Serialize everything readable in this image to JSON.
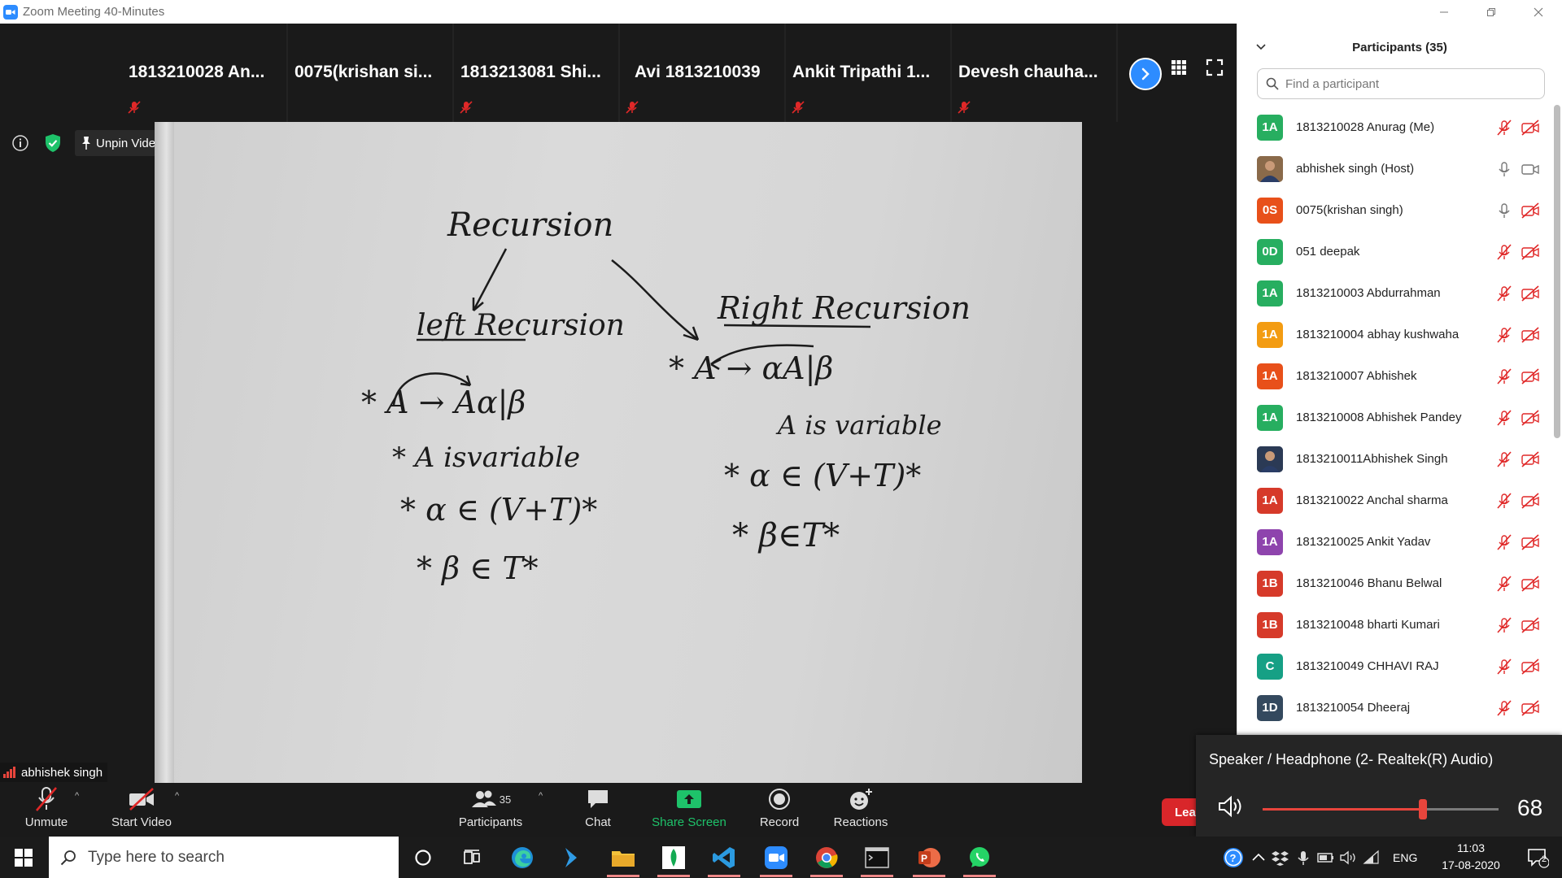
{
  "window": {
    "title": "Zoom Meeting 40-Minutes",
    "controls": [
      "minimize",
      "restore",
      "close"
    ]
  },
  "video_strip": [
    {
      "name": "1813210028  An..."
    },
    {
      "name": "0075(krishan  si..."
    },
    {
      "name": "1813213081  Shi..."
    },
    {
      "name": "Avi 1813210039"
    },
    {
      "name": "Ankit  Tripathi  1..."
    },
    {
      "name": "Devesh  chauha..."
    }
  ],
  "main_video": {
    "unpin_label": "Unpin Video",
    "speaker_name": "abhishek singh",
    "whiteboard": {
      "title": "Recursion",
      "left_heading": "left  Recursion",
      "right_heading": "Right  Recursion",
      "left_lines": [
        "* A → Aα|β",
        "* A isvariable",
        "* α ∈ (V+T)*",
        "* β ∈ T*"
      ],
      "right_lines": [
        "* A → αA|β",
        "A is variable",
        "* α ∈ (V+T)*",
        "* β∈T*"
      ]
    }
  },
  "toolbar": {
    "unmute": "Unmute",
    "start_video": "Start Video",
    "participants": "Participants",
    "participants_count": "35",
    "chat": "Chat",
    "share_screen": "Share Screen",
    "record": "Record",
    "reactions": "Reactions",
    "leave": "Leave"
  },
  "participants_panel": {
    "title": "Participants (35)",
    "search_placeholder": "Find a participant",
    "participants": [
      {
        "initials": "1A",
        "name": "1813210028 Anurag (Me)",
        "color": "#27ae60",
        "mic": "muted",
        "video": "off"
      },
      {
        "initials": "",
        "name": "abhishek singh (Host)",
        "color": "#8a6a4a",
        "mic": "on",
        "video": "on",
        "photo": true
      },
      {
        "initials": "0S",
        "name": "0075(krishan singh)",
        "color": "#e8501a",
        "mic": "on",
        "video": "off"
      },
      {
        "initials": "0D",
        "name": "051 deepak",
        "color": "#27ae60",
        "mic": "muted",
        "video": "off"
      },
      {
        "initials": "1A",
        "name": "1813210003 Abdurrahman",
        "color": "#27ae60",
        "mic": "muted",
        "video": "off"
      },
      {
        "initials": "1A",
        "name": "1813210004 abhay kushwaha",
        "color": "#f39c12",
        "mic": "muted",
        "video": "off"
      },
      {
        "initials": "1A",
        "name": "1813210007 Abhishek",
        "color": "#e8501a",
        "mic": "muted",
        "video": "off"
      },
      {
        "initials": "1A",
        "name": "1813210008 Abhishek Pandey",
        "color": "#27ae60",
        "mic": "muted",
        "video": "off"
      },
      {
        "initials": "",
        "name": "1813210011Abhishek Singh",
        "color": "#2b3a55",
        "mic": "muted",
        "video": "off",
        "photo": true
      },
      {
        "initials": "1A",
        "name": "1813210022 Anchal sharma",
        "color": "#d63a2a",
        "mic": "muted",
        "video": "off"
      },
      {
        "initials": "1A",
        "name": "1813210025 Ankit Yadav",
        "color": "#8e44ad",
        "mic": "muted",
        "video": "off"
      },
      {
        "initials": "1B",
        "name": "1813210046 Bhanu Belwal",
        "color": "#d63a2a",
        "mic": "muted",
        "video": "off"
      },
      {
        "initials": "1B",
        "name": "1813210048 bharti Kumari",
        "color": "#d63a2a",
        "mic": "muted",
        "video": "off"
      },
      {
        "initials": "C",
        "name": "1813210049 CHHAVI RAJ",
        "color": "#16a085",
        "mic": "muted",
        "video": "off"
      },
      {
        "initials": "1D",
        "name": "1813210054 Dheeraj",
        "color": "#34495e",
        "mic": "muted",
        "video": "off"
      }
    ]
  },
  "volume_popup": {
    "device": "Speaker / Headphone (2- Realtek(R) Audio)",
    "value": "68",
    "level_fraction": 0.68
  },
  "taskbar": {
    "search_placeholder": "Type here to search",
    "apps": [
      "cortana",
      "task-view",
      "edge",
      "visual-studio",
      "file-explorer",
      "mongodb-compass",
      "vscode",
      "zoom",
      "chrome",
      "terminal",
      "powerpoint",
      "whatsapp"
    ],
    "language": "ENG",
    "time": "11:03",
    "date": "17-08-2020",
    "notifications": "2"
  }
}
